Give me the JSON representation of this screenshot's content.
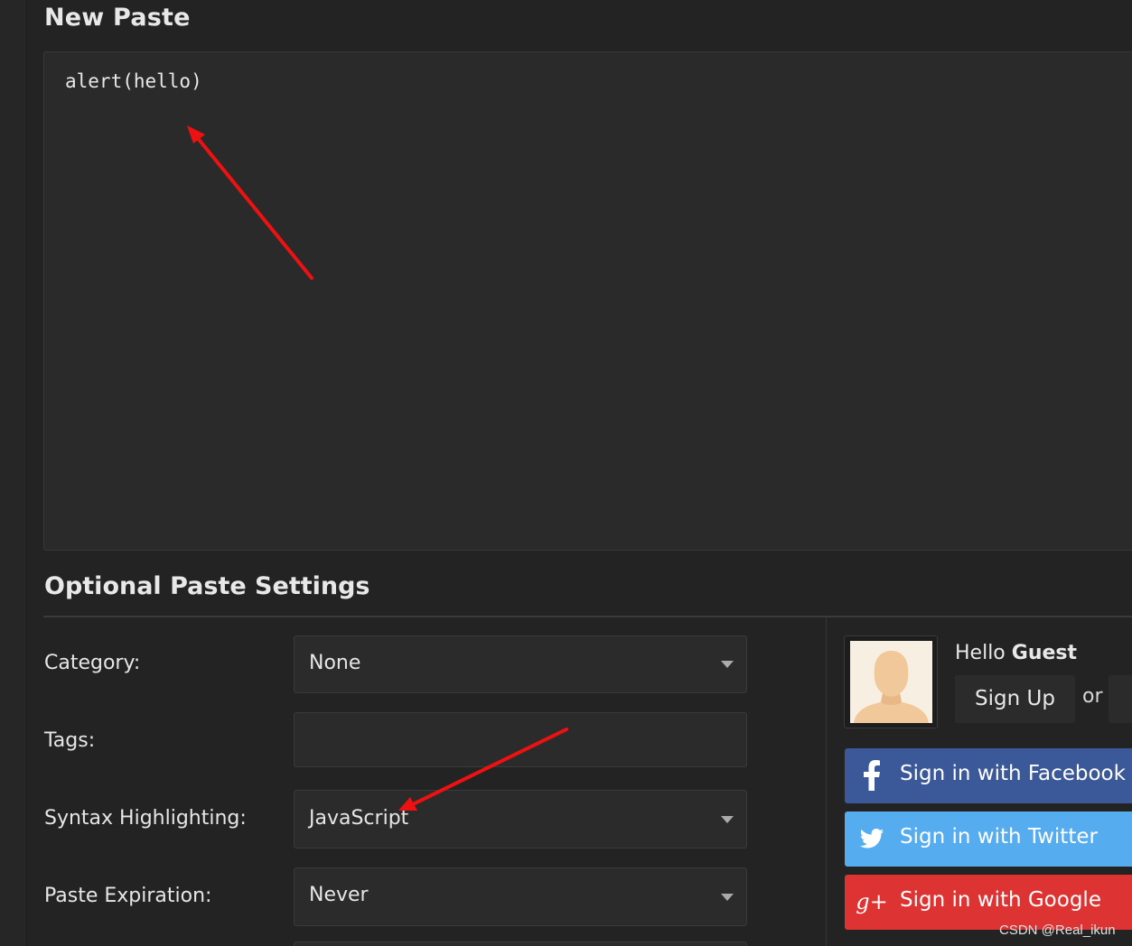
{
  "page": {
    "title": "New Paste"
  },
  "editor": {
    "content": "alert(hello)"
  },
  "settings": {
    "title": "Optional Paste Settings",
    "category": {
      "label": "Category:",
      "value": "None"
    },
    "tags": {
      "label": "Tags:",
      "value": ""
    },
    "syntax": {
      "label": "Syntax Highlighting:",
      "value": "JavaScript"
    },
    "expiration": {
      "label": "Paste Expiration:",
      "value": "Never"
    }
  },
  "user_panel": {
    "hello_prefix": "Hello",
    "username": "Guest",
    "signup_label": "Sign Up",
    "or_text": "or"
  },
  "social": {
    "facebook_label": "Sign in with Facebook",
    "twitter_label": "Sign in with Twitter",
    "google_label": "Sign in with Google",
    "google_icon_text": "g+",
    "facebook_color": "#3b5998",
    "twitter_color": "#55acee",
    "google_color": "#dd3333"
  },
  "annotation_color": "#ee1111",
  "watermark": "CSDN @Real_ikun",
  "icons": [
    "facebook-icon",
    "twitter-icon",
    "google-plus-icon",
    "dropdown-caret-icon",
    "default-avatar-icon"
  ]
}
